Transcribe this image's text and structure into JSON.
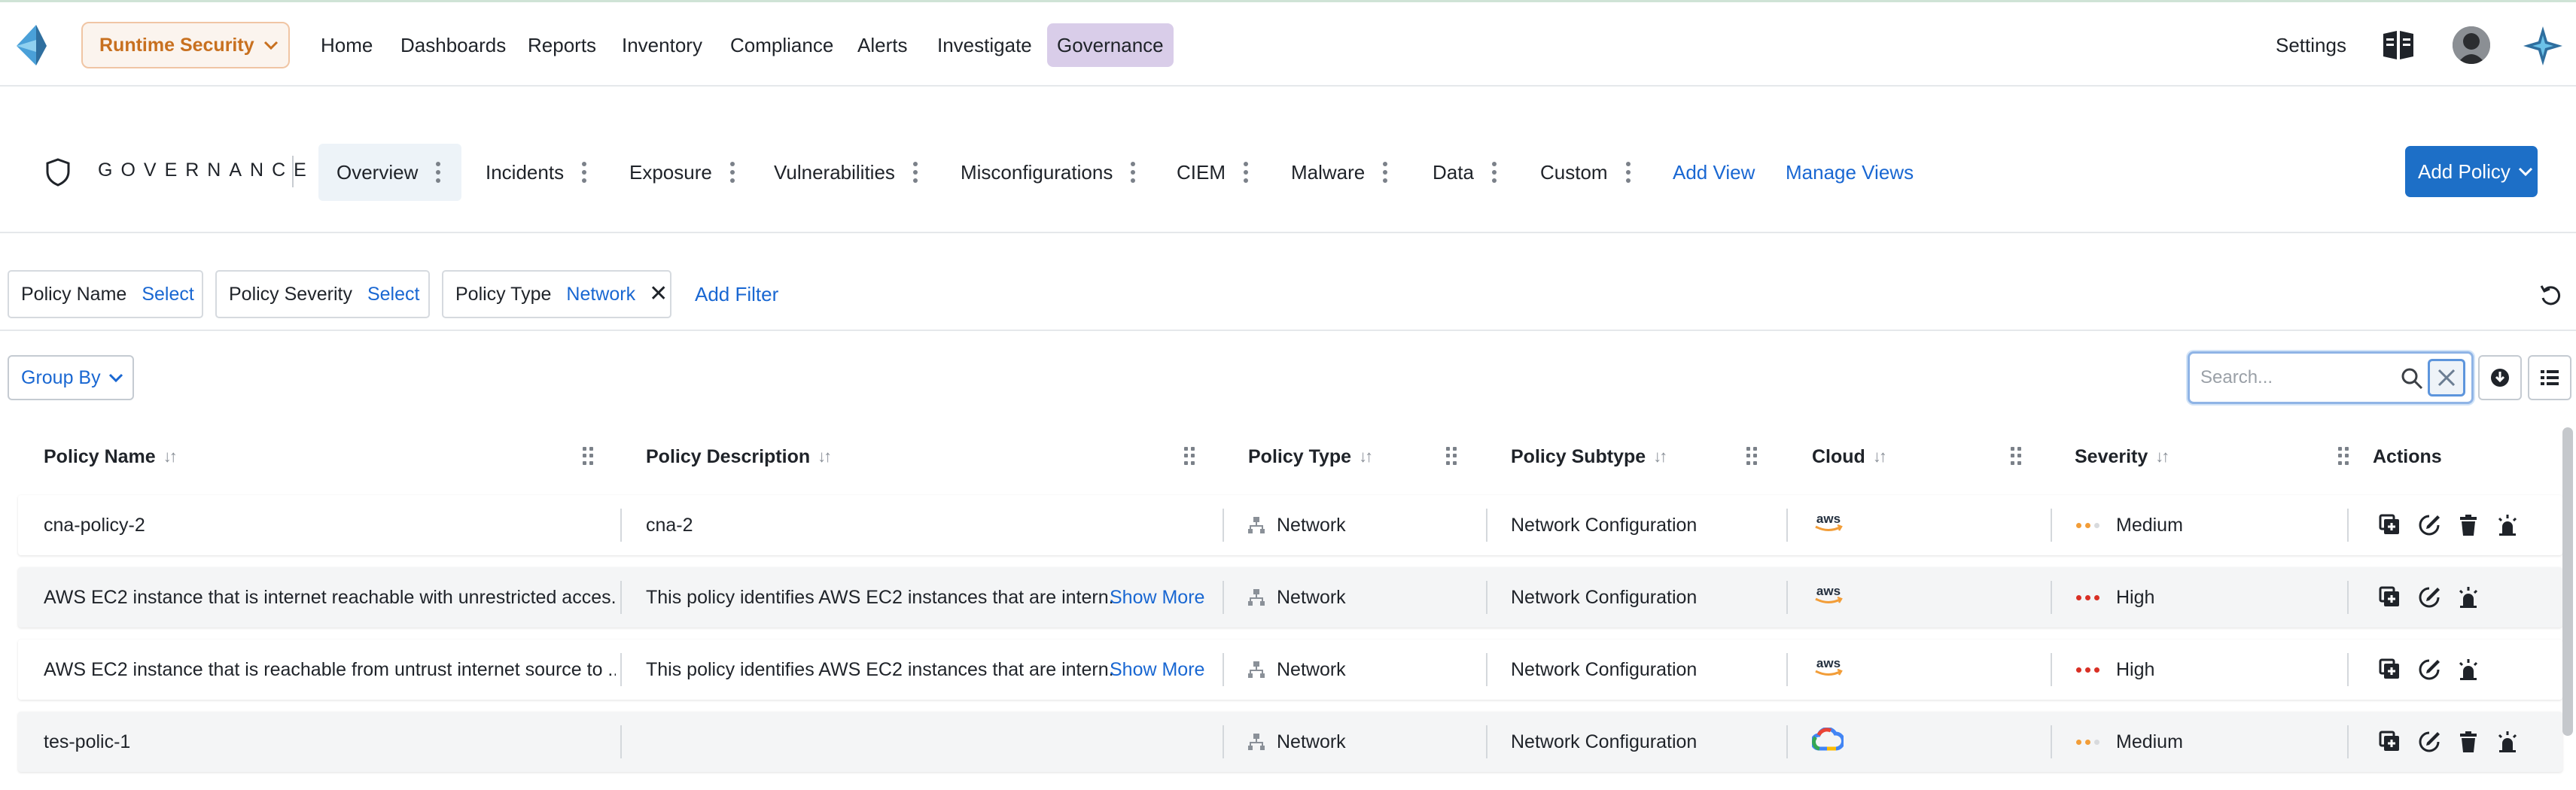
{
  "topnav": {
    "product_switcher": "Runtime Security",
    "links": [
      "Home",
      "Dashboards",
      "Reports",
      "Inventory",
      "Compliance",
      "Alerts",
      "Investigate",
      "Governance"
    ],
    "active_link": "Governance",
    "settings": "Settings"
  },
  "governance": {
    "title": "GOVERNANCE",
    "tabs": [
      "Overview",
      "Incidents",
      "Exposure",
      "Vulnerabilities",
      "Misconfigurations",
      "CIEM",
      "Malware",
      "Data",
      "Custom"
    ],
    "active_tab": "Overview",
    "add_view": "Add View",
    "manage_views": "Manage Views",
    "add_policy": "Add Policy"
  },
  "filters": {
    "items": [
      {
        "label": "Policy Name",
        "value": "Select"
      },
      {
        "label": "Policy Severity",
        "value": "Select"
      },
      {
        "label": "Policy Type",
        "value": "Network"
      }
    ],
    "add_filter": "Add Filter"
  },
  "toolbar": {
    "group_by": "Group By",
    "search_placeholder": "Search..."
  },
  "table": {
    "columns": [
      "Policy Name",
      "Policy Description",
      "Policy Type",
      "Policy Subtype",
      "Cloud",
      "Severity",
      "Actions"
    ],
    "show_more": "Show More",
    "rows": [
      {
        "name": "cna-policy-2",
        "description": "cna-2",
        "has_more": false,
        "type": "Network",
        "subtype": "Network Configuration",
        "cloud": "aws",
        "severity": "Medium",
        "actions": 4
      },
      {
        "name": "AWS EC2 instance that is internet reachable with unrestricted acces...",
        "description": "This policy identifies AWS EC2 instances that are intern...",
        "has_more": true,
        "type": "Network",
        "subtype": "Network Configuration",
        "cloud": "aws",
        "severity": "High",
        "actions": 3
      },
      {
        "name": "AWS EC2 instance that is reachable from untrust internet source to ...",
        "description": "This policy identifies AWS EC2 instances that are intern...",
        "has_more": true,
        "type": "Network",
        "subtype": "Network Configuration",
        "cloud": "aws",
        "severity": "High",
        "actions": 3
      },
      {
        "name": "tes-polic-1",
        "description": "",
        "has_more": false,
        "type": "Network",
        "subtype": "Network Configuration",
        "cloud": "gcp",
        "severity": "Medium",
        "actions": 4
      }
    ]
  },
  "colors": {
    "accent_blue": "#1d6fc7",
    "link_blue": "#1967d2",
    "product_orange": "#c8701f",
    "active_nav_purple": "#d9cde9",
    "severity_high": "#d93025",
    "severity_medium": "#f29d38"
  },
  "icons": {
    "logo": "prisma-logo-icon",
    "book": "book-icon",
    "assistant": "sparkle-icon",
    "shield": "shield-icon",
    "reset": "reset-icon",
    "search": "search-icon",
    "clear": "close-icon",
    "download": "download-icon",
    "columns": "columns-icon",
    "network": "network-icon",
    "aws": "aws-logo",
    "gcp": "gcp-logo"
  }
}
